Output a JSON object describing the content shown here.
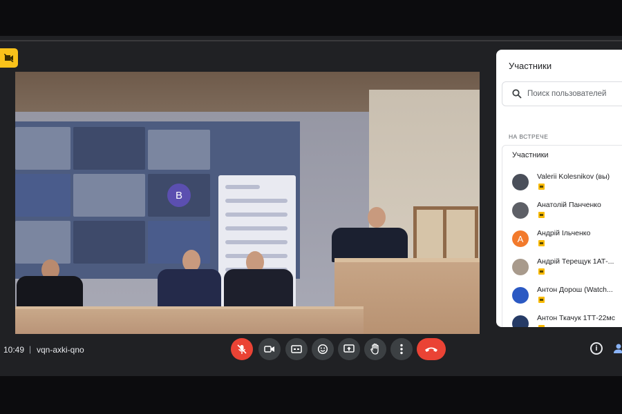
{
  "meeting": {
    "time": "10:49",
    "separator": "|",
    "code": "vqn-axki-qno"
  },
  "panel": {
    "title": "Участники",
    "search_placeholder": "Поиск пользователей",
    "section_label": "НА ВСТРЕЧЕ",
    "group_label": "Участники",
    "participants": [
      {
        "name": "Valerii Kolesnikov (вы)",
        "avatar_letter": "",
        "avatar_color": "#4a4f5a"
      },
      {
        "name": "Анатолій Панченко",
        "avatar_letter": "",
        "avatar_color": "#5d5f66"
      },
      {
        "name": "Андрій Ільченко",
        "avatar_letter": "А",
        "avatar_color": "#f27a2c"
      },
      {
        "name": "Андрій Терещук 1АТ-...",
        "avatar_letter": "",
        "avatar_color": "#a89a8c"
      },
      {
        "name": "Антон Дорош (Watch...",
        "avatar_letter": "",
        "avatar_color": "#2b59c3"
      },
      {
        "name": "Антон Ткачук 1ТТ-22мс",
        "avatar_letter": "",
        "avatar_color": "#263b66"
      }
    ]
  },
  "video": {
    "screen_avatar_letter": "B"
  },
  "controls": [
    {
      "id": "mic",
      "icon": "mic-off-icon",
      "color": "#ea4335"
    },
    {
      "id": "camera",
      "icon": "video-camera-icon",
      "color": "#3c4043"
    },
    {
      "id": "captions",
      "icon": "captions-icon",
      "color": "#3c4043"
    },
    {
      "id": "emoji",
      "icon": "emoji-icon",
      "color": "#3c4043"
    },
    {
      "id": "present",
      "icon": "present-screen-icon",
      "color": "#3c4043"
    },
    {
      "id": "raise-hand",
      "icon": "raise-hand-icon",
      "color": "#3c4043"
    },
    {
      "id": "more",
      "icon": "more-vert-icon",
      "color": "#3c4043"
    },
    {
      "id": "hangup",
      "icon": "call-end-icon",
      "color": "#ea4335"
    }
  ],
  "colors": {
    "app_background": "#202124",
    "accent_red": "#ea4335",
    "badge_yellow": "#f9c21a"
  }
}
